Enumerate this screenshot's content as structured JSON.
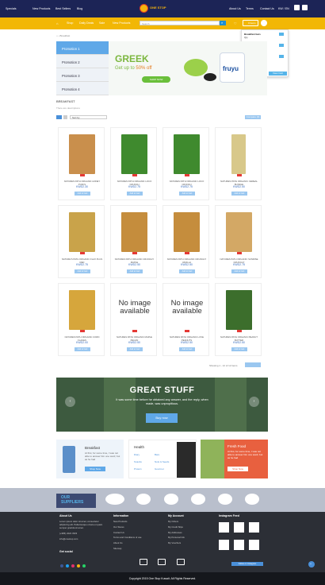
{
  "header": {
    "nav": [
      "Specials",
      "New Products",
      "Best Sellers",
      "Blog"
    ],
    "logo_text": "ONE STOP",
    "right": [
      "About Us",
      "Terms",
      "Contact Us",
      "KW / EN"
    ]
  },
  "menubar": {
    "items": [
      "Shop",
      "Daily Deals",
      "Sale",
      "New Products"
    ],
    "search_placeholder": "Search",
    "cart_label": "0 items"
  },
  "cart_dropdown": {
    "items": [
      {
        "name": "Breakfast bars",
        "sub": "Qty"
      },
      {
        "name": "Breakfast bars",
        "sub": "Qty"
      },
      {
        "name": "Breakfast bars",
        "sub": "Qty"
      }
    ],
    "total": "Subtotal: 10 KT",
    "checkout": "Checkout",
    "view": "View Cart"
  },
  "breadcrumb": "Breakfast",
  "promos": [
    "Promotion 1",
    "Promotion 2",
    "Promotion 3",
    "Promotion 4"
  ],
  "hero": {
    "title": "GREEK",
    "subtitle_a": "Get up to ",
    "subtitle_b": "50% off",
    "cta": "SHOP NOW",
    "brand": "fruyu"
  },
  "category": {
    "title": "BREAKFAST",
    "desc": "There are descriptions",
    "sort": "Sort by",
    "compare": "Compare (0)"
  },
  "products": [
    {
      "name": "NATURES PATH ORGANIC HONEY PUFFS",
      "price": "KWD2.30",
      "add": "Add to Cart",
      "img": "#c98f4c"
    },
    {
      "name": "NATURES PATH ORGANIC LOCO CRUNCH",
      "price": "KWD2.75",
      "add": "Add to Cart",
      "img": "#3f8a2e"
    },
    {
      "name": "NATURES PATH ORGANIC LOCO CRUNCH",
      "price": "KWD2.75",
      "add": "Add to Cart",
      "img": "#3f8a2e"
    },
    {
      "name": "NATURES PATH ORGANIC CEREAL BUNDLE",
      "price": "KWD2.50",
      "add": "Add to Cart",
      "img": "#d8c88a"
    },
    {
      "name": "NATURE'S PATH ORGANIC FLAX PLUS RED",
      "price": "KWD2.75",
      "add": "Add to Cart",
      "img": "#c9a34a"
    },
    {
      "name": "NATURES PATH ORGANIC CRUNCHY MAPLE",
      "price": "KWD2.50",
      "add": "Add to Cart",
      "img": "#c58d3d"
    },
    {
      "name": "NATURES PATH ORGANIC CRUNCHY VANILLA",
      "price": "KWD2.50",
      "add": "Add to Cart",
      "img": "#c58d3d"
    },
    {
      "name": "NATURES PATH ORGANIC SUNRISE CRUNCHY",
      "price": "KWD2.75",
      "add": "Add to Cart",
      "img": "#d3a865"
    },
    {
      "name": "NATURES PATH ORGANIC CORN FLAKES",
      "price": "KWD2.00",
      "add": "Add to Cart",
      "img": "#d6a63c"
    },
    {
      "name": "NATURES PATH ORGANIC MAPLE PECAN",
      "price": "KWD2.50",
      "add": "Add to Cart",
      "noimg": "No image available"
    },
    {
      "name": "NATURES PATH ORGANIC LOVE PEANUTS",
      "price": "KWD2.50",
      "add": "Add to Cart",
      "noimg": "No image available"
    },
    {
      "name": "NATURES PATH ORGANIC PEANUT BUTTER",
      "price": "KWD2.50",
      "add": "Add to Cart",
      "img": "#3c6e2c"
    }
  ],
  "pager": "Showing 1 - 12 of 12 items",
  "banner": {
    "title": "GREAT STUFF",
    "desc": "It was some time before he obtained any answer, and the reply, when made, was unpropitious.",
    "cta": "Buy now"
  },
  "minis": [
    {
      "title": "Breakfast",
      "text": "At first, for some time, I was not able to answer him one word; but as he had",
      "cta": "Shop Now"
    },
    {
      "title": "Health",
      "links": [
        "Diary",
        "Bars",
        "Snacks",
        "Nuts & Seeds",
        "Protein",
        "Gourmet"
      ]
    },
    {
      "title": "Fresh Food",
      "text": "At first, for some time, I was not able to answer him one word; but as he had",
      "cta": "Shop Now"
    }
  ],
  "suppliers": {
    "label_a": "OUR",
    "label_b": "SUPPLIERS"
  },
  "footer": {
    "about": {
      "title": "About Us",
      "text": "Lorem ipsum dolor sit amet, consectetur adipiscing elit. Pellentesque ornare et quam semper gravida sit amet.",
      "phone": "(+965) 2222 3333",
      "email": "info@onestop.com",
      "social": "Get social"
    },
    "info": {
      "title": "Information",
      "links": [
        "New Products",
        "Our Stores",
        "Contact Us",
        "Terms and Conditions of use",
        "About Us",
        "Sitemap"
      ]
    },
    "account": {
      "title": "My Account",
      "links": [
        "My Orders",
        "My Credit Slips",
        "My Addresses",
        "My Personal Info",
        "My Vouchers"
      ]
    },
    "insta": {
      "title": "Instagram Feed",
      "follow": "Follow on Instagram"
    }
  },
  "copyright": "Copyright 2015 One Stop Kuwait. All Rights Reserved.",
  "colors": {
    "navy": "#1c2456",
    "yellow": "#f2b705",
    "blue": "#5fa8e8"
  }
}
